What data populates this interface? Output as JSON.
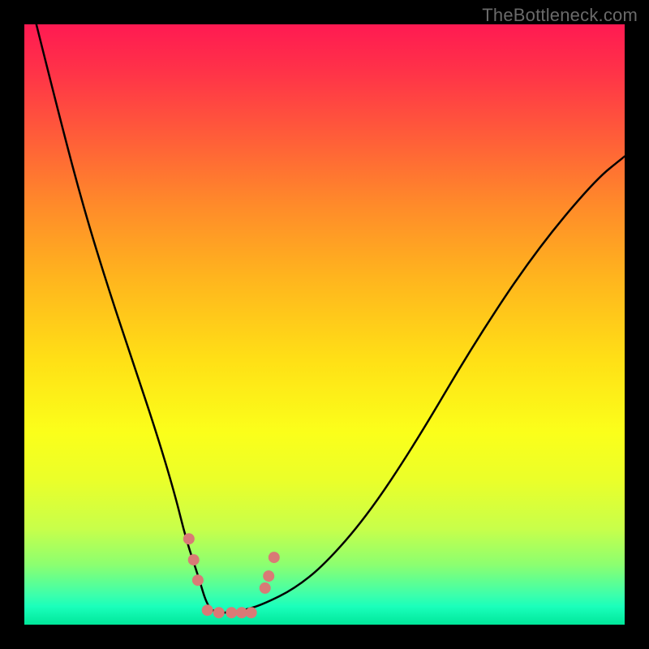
{
  "watermark": "TheBottleneck.com",
  "chart_data": {
    "type": "line",
    "title": "",
    "xlabel": "",
    "ylabel": "",
    "xlim": [
      0,
      100
    ],
    "ylim": [
      0,
      100
    ],
    "background_gradient": {
      "top": "#ff1a52",
      "bottom": "#00e79a",
      "description": "vertical rainbow gradient red→orange→yellow→green suggesting bottleneck severity (red high, green low)"
    },
    "series": [
      {
        "name": "bottleneck-curve",
        "x": [
          2,
          6,
          10,
          14,
          18,
          22,
          25,
          27,
          29,
          30.5,
          32,
          34,
          37,
          40,
          45,
          50,
          57,
          65,
          75,
          85,
          95,
          100
        ],
        "y": [
          100,
          84,
          69,
          56,
          44,
          32,
          22,
          14,
          8,
          3,
          2,
          2,
          2.5,
          3.5,
          6,
          10,
          18,
          30,
          47,
          62,
          74,
          78
        ]
      }
    ],
    "markers": [
      {
        "x": 27.4,
        "y": 14.3
      },
      {
        "x": 28.2,
        "y": 10.8
      },
      {
        "x": 28.9,
        "y": 7.4
      },
      {
        "x": 30.5,
        "y": 2.4
      },
      {
        "x": 32.4,
        "y": 2.0
      },
      {
        "x": 34.5,
        "y": 2.0
      },
      {
        "x": 36.2,
        "y": 2.0
      },
      {
        "x": 37.8,
        "y": 2.0
      },
      {
        "x": 40.1,
        "y": 6.1
      },
      {
        "x": 40.7,
        "y": 8.1
      },
      {
        "x": 41.6,
        "y": 11.2
      }
    ],
    "marker_style": {
      "color": "#d97a76",
      "radius_px": 7
    }
  }
}
